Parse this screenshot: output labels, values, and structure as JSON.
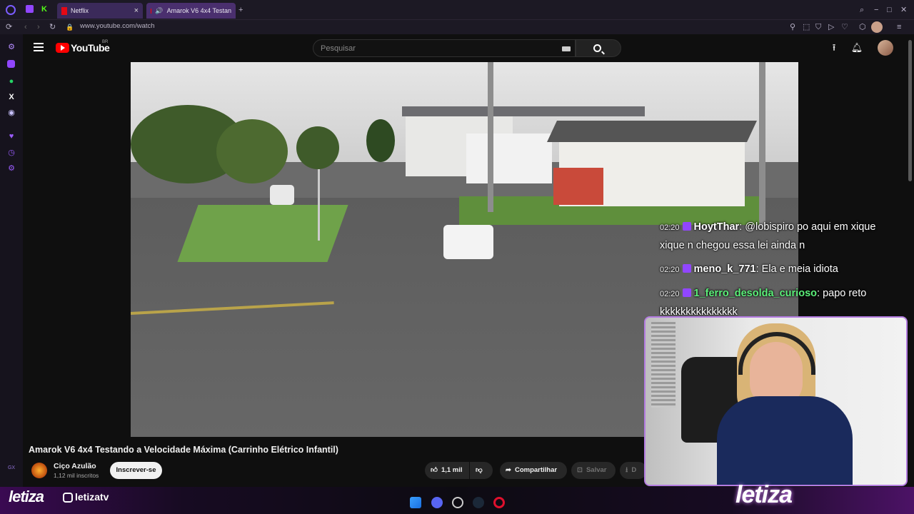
{
  "browser": {
    "tabs": [
      {
        "label": "Netflix",
        "icon": "netflix-icon"
      },
      {
        "label": "Amarok V6 4x4 Testan",
        "icon": "youtube-icon"
      }
    ],
    "url": "www.youtube.com/watch",
    "accent": "#9146ff"
  },
  "youtube": {
    "logo_text": "YouTube",
    "country": "BR",
    "search_placeholder": "Pesquisar"
  },
  "video": {
    "title": "Amarok V6 4x4 Testando a Velocidade Máxima (Carrinho Elétrico Infantil)",
    "channel": "Ciço Azulão",
    "subscribers": "1,12 mil inscritos",
    "subscribe_label": "Inscrever-se",
    "likes": "1,1 mil",
    "share_label": "Compartilhar",
    "save_label": "Salvar",
    "download_label": "D"
  },
  "chat": [
    {
      "time": "02:20",
      "user": "HoytThar",
      "color": "#ffffff",
      "text": "@lobispiro po aqui em xique xique n chegou essa lei ainda n"
    },
    {
      "time": "02:20",
      "user": "meno_k_771",
      "color": "#ffffff",
      "text": "Ela e meia idiota"
    },
    {
      "time": "02:20",
      "user": "1_ferro_desolda_curioso",
      "color": "#5cf07a",
      "text": "papo reto kkkkkkkkkkkkkkk"
    }
  ],
  "overlay": {
    "brand_small": "letiza",
    "instagram": "letizatv",
    "brand_large": "letiza"
  }
}
